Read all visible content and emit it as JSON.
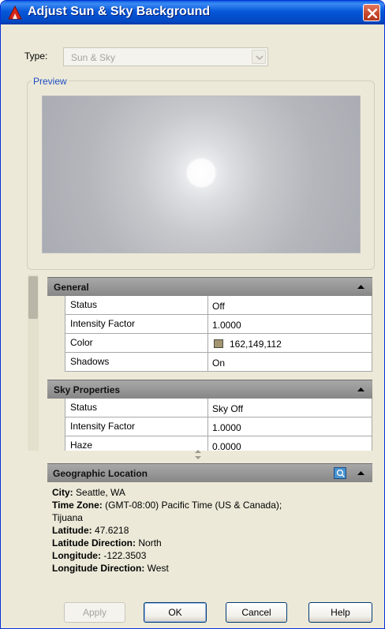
{
  "window": {
    "title": "Adjust Sun & Sky Background",
    "close_label": "Close"
  },
  "type_field": {
    "label": "Type:",
    "value": "Sun & Sky"
  },
  "preview": {
    "legend": "Preview"
  },
  "general": {
    "header": "General",
    "rows": [
      {
        "name": "Status",
        "value": "Off"
      },
      {
        "name": "Intensity Factor",
        "value": "1.0000"
      },
      {
        "name": "Color",
        "value": "162,149,112",
        "swatch": "#A29570"
      },
      {
        "name": "Shadows",
        "value": "On"
      }
    ]
  },
  "sky": {
    "header": "Sky Properties",
    "rows": [
      {
        "name": "Status",
        "value": "Sky Off"
      },
      {
        "name": "Intensity Factor",
        "value": "1.0000"
      },
      {
        "name": "Haze",
        "value": "0.0000"
      }
    ]
  },
  "geo": {
    "header": "Geographic Location",
    "city_label": "City:",
    "city": "Seattle, WA",
    "timezone_label": "Time Zone:",
    "timezone": "(GMT-08:00) Pacific Time (US & Canada);",
    "timezone_cont": "Tijuana",
    "lat_label": "Latitude:",
    "lat": "47.6218",
    "latdir_label": "Latitude Direction:",
    "latdir": "North",
    "lon_label": "Longitude:",
    "lon": "-122.3503",
    "londir_label": "Longitude Direction:",
    "londir": "West"
  },
  "buttons": {
    "apply": "Apply",
    "ok": "OK",
    "cancel": "Cancel",
    "help": "Help"
  }
}
